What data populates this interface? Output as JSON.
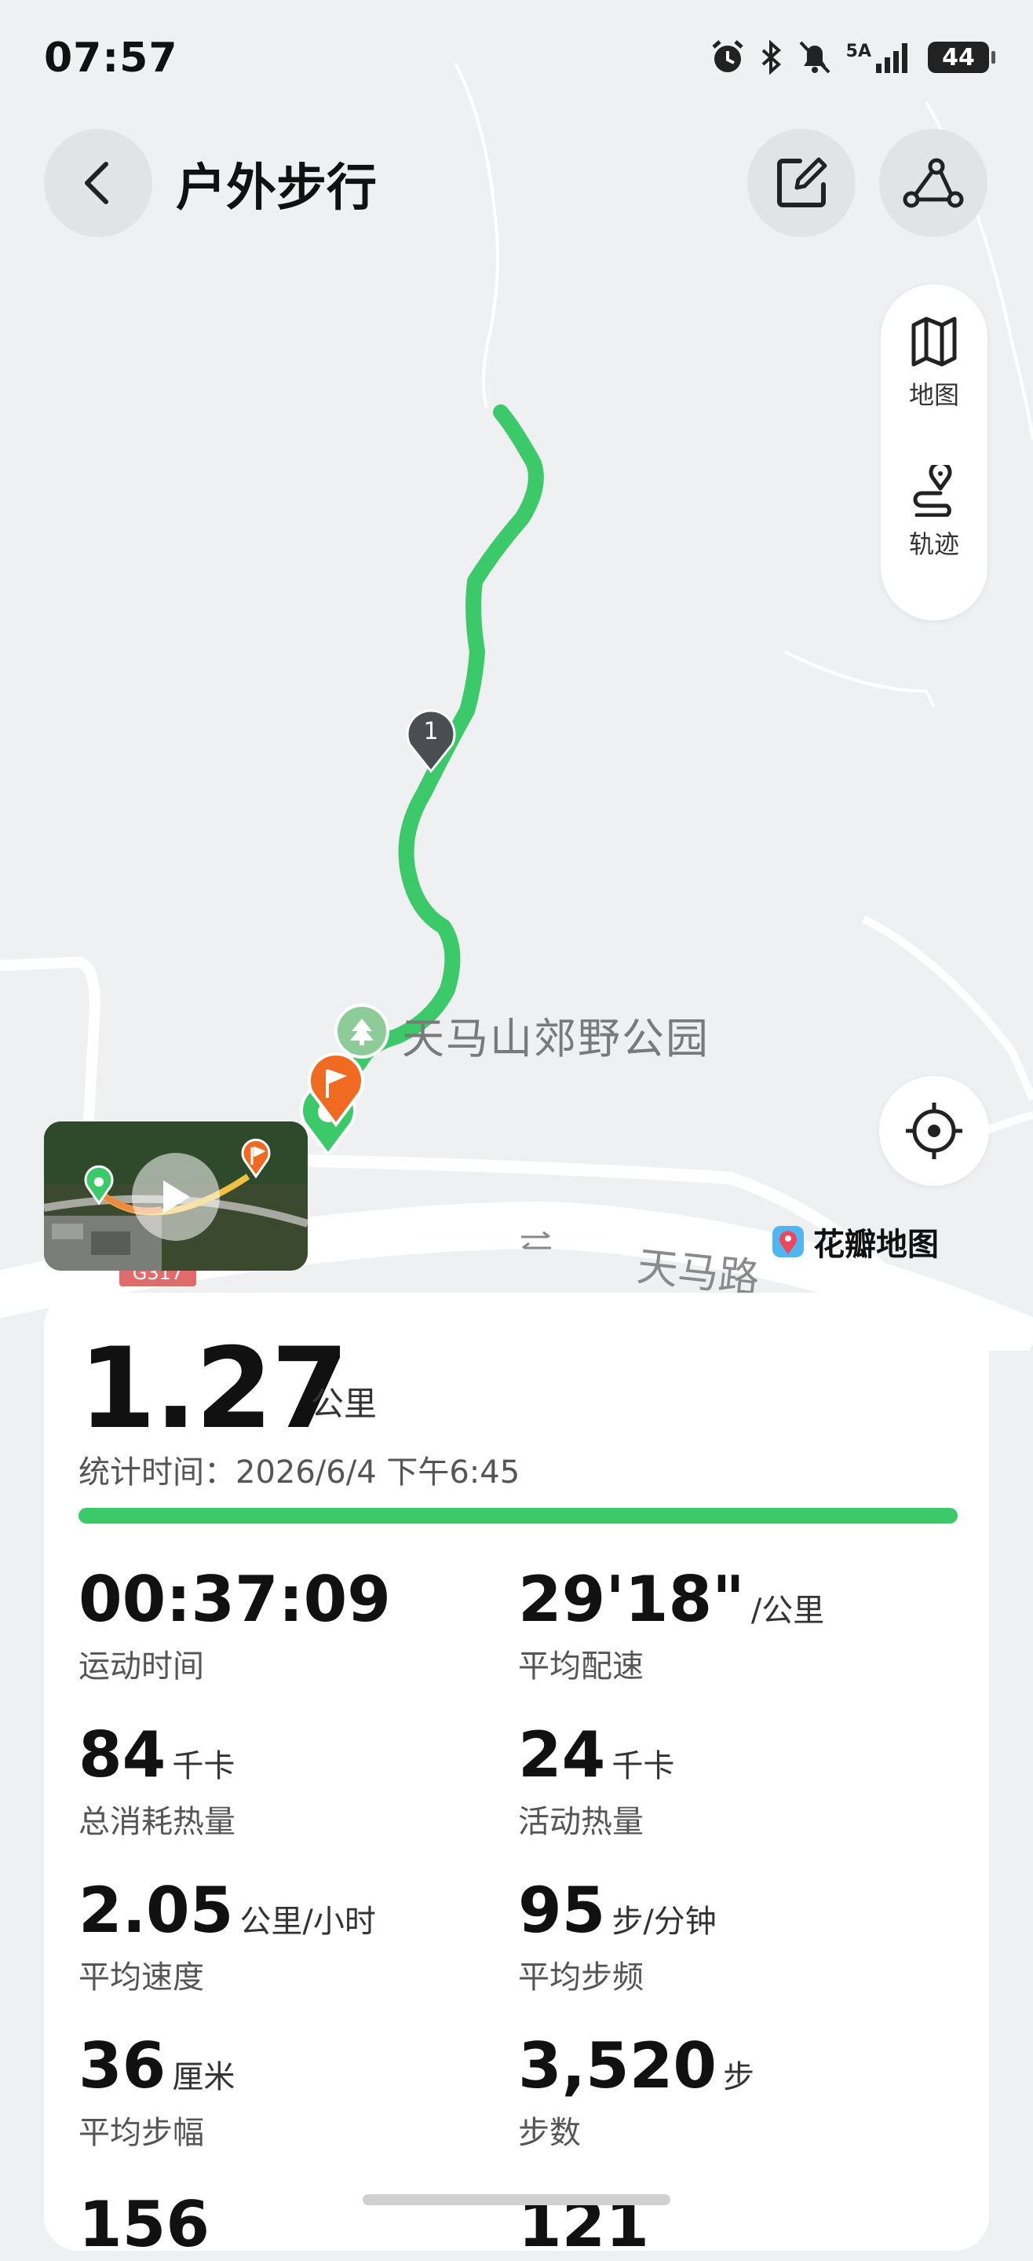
{
  "status_bar": {
    "time": "07:57",
    "network": "5A",
    "battery": "44"
  },
  "header": {
    "title": "户外步行"
  },
  "side_panel": {
    "map_label": "地图",
    "track_label": "轨迹"
  },
  "map": {
    "poi_name": "天马山郊野公园",
    "road_name": "天马路",
    "attribution": "花瓣地图",
    "marker_number": "1",
    "highway_code": "G317",
    "route_color": "#3cc96a",
    "end_color": "#f06a22"
  },
  "summary": {
    "distance": "1.27",
    "distance_unit": "公里",
    "stat_time": "统计时间：2026/6/4 下午6:45"
  },
  "stats": [
    {
      "value": "00:37:09",
      "unit": "",
      "label": "运动时间"
    },
    {
      "value": "29'18\"",
      "unit": "/公里",
      "label": "平均配速"
    },
    {
      "value": "84",
      "unit": "千卡",
      "label": "总消耗热量"
    },
    {
      "value": "24",
      "unit": "千卡",
      "label": "活动热量"
    },
    {
      "value": "2.05",
      "unit": "公里/小时",
      "label": "平均速度"
    },
    {
      "value": "95",
      "unit": "步/分钟",
      "label": "平均步频"
    },
    {
      "value": "36",
      "unit": "厘米",
      "label": "平均步幅"
    },
    {
      "value": "3,520",
      "unit": "步",
      "label": "步数"
    },
    {
      "value": "156",
      "unit": "",
      "label": ""
    },
    {
      "value": "121",
      "unit": "",
      "label": ""
    }
  ]
}
